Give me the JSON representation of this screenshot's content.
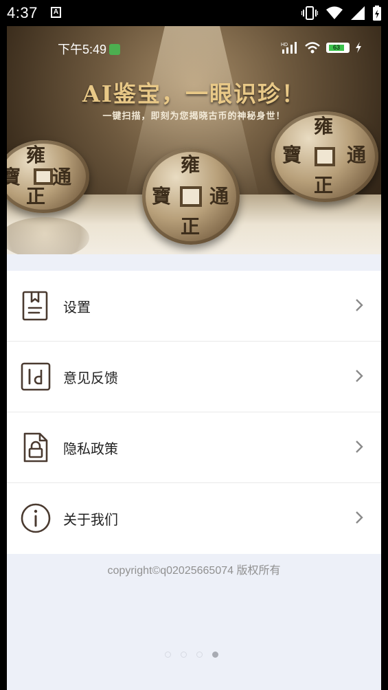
{
  "system_status": {
    "time": "4:37",
    "app_indicator": "A",
    "icons": [
      "vibrate-icon",
      "wifi-icon",
      "signal-icon",
      "battery-charging-icon"
    ]
  },
  "banner": {
    "status_time": "下午5:49",
    "network_badge": "HD",
    "battery_level": "63",
    "headline": "AI鉴宝，一眼识珍！",
    "subline": "一键扫描，即刻为您揭晓古币的神秘身世！",
    "coin_characters": [
      "雍",
      "正",
      "通",
      "寶"
    ]
  },
  "menu": {
    "items": [
      {
        "label": "设置",
        "icon": "settings-book-icon"
      },
      {
        "label": "意见反馈",
        "icon": "feedback-icon"
      },
      {
        "label": "隐私政策",
        "icon": "privacy-lock-icon"
      },
      {
        "label": "关于我们",
        "icon": "info-icon"
      }
    ]
  },
  "footer": {
    "copyright": "copyright©q02025665074 版权所有"
  },
  "pager": {
    "count": 4,
    "active_index": 3
  },
  "colors": {
    "icon_brown": "#4a3a30",
    "headline_gold": "#e8c887",
    "page_bg": "#edf0f8"
  }
}
